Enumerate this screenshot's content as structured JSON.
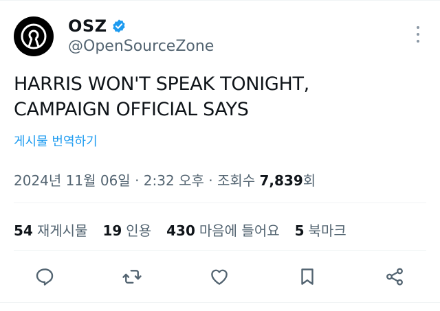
{
  "account": {
    "display_name": "OSZ",
    "handle": "@OpenSourceZone",
    "verified": true
  },
  "tweet": {
    "text": "HARRIS WON'T SPEAK TONIGHT,\nCAMPAIGN OFFICIAL SAYS",
    "translate_link": "게시물 번역하기"
  },
  "meta": {
    "date": "2024년 11월 06일",
    "separator1": " · ",
    "time": "2:32 오후",
    "separator2": " · ",
    "views_label": "조회수 ",
    "views_count": "7,839",
    "views_suffix": "회"
  },
  "stats": {
    "reposts_count": "54",
    "reposts_label": "재게시물",
    "quotes_count": "19",
    "quotes_label": "인용",
    "likes_count": "430",
    "likes_label": "마음에 들어요",
    "bookmarks_count": "5",
    "bookmarks_label": "북마크"
  },
  "icons": {
    "verified": "verified-badge-icon",
    "more": "more-vertical-icon",
    "reply": "reply-icon",
    "repost": "repost-icon",
    "like": "heart-icon",
    "bookmark": "bookmark-icon",
    "share": "share-icon"
  },
  "colors": {
    "accent": "#1d9bf0",
    "text": "#0f1419",
    "secondary": "#536471",
    "icon": "#536471"
  }
}
